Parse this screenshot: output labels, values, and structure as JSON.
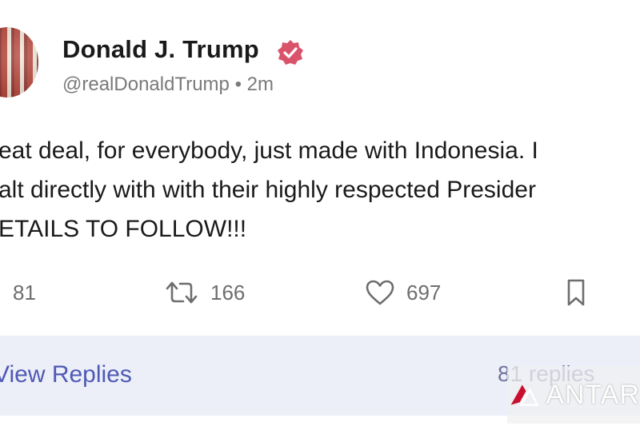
{
  "post": {
    "author_name": "Donald J. Trump",
    "handle": "@realDonaldTrump",
    "separator": "•",
    "time_ago": "2m",
    "text_lines": [
      "eat deal, for everybody, just made with Indonesia. I",
      "alt directly with with their highly respected Presider",
      "ETAILS TO FOLLOW!!!"
    ]
  },
  "actions": {
    "replies": "81",
    "reposts": "166",
    "likes": "697"
  },
  "footer": {
    "view_replies_label": "View Replies",
    "replies_count_label": "81 replies"
  },
  "watermark": {
    "text": "ANTAR"
  },
  "colors": {
    "verified_badge": "#d9536b",
    "link_blue": "#4f5ab3",
    "footer_bg": "#eceef8",
    "muted_text": "#6e6e6e"
  },
  "icons": [
    "verified-badge-icon",
    "reply-icon",
    "repost-icon",
    "heart-icon",
    "bookmark-icon",
    "antara-logo-icon"
  ]
}
